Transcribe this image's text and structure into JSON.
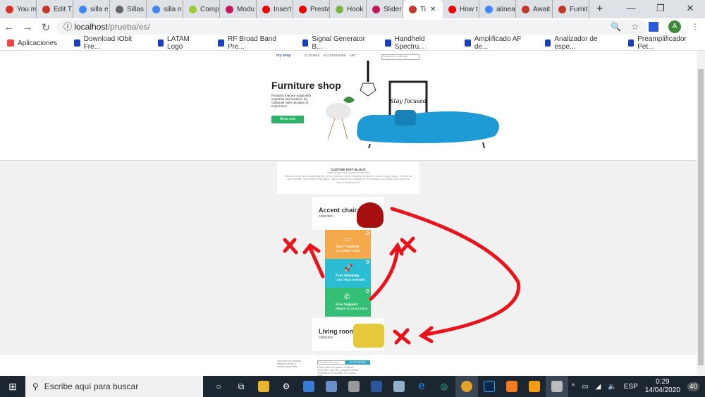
{
  "browser": {
    "tabs": [
      {
        "label": "You m",
        "color": "#d93025"
      },
      {
        "label": "Edit T",
        "color": "#c0392b"
      },
      {
        "label": "silla e",
        "color": "#4285f4"
      },
      {
        "label": "Sillas",
        "color": "#666"
      },
      {
        "label": "silla n",
        "color": "#4285f4"
      },
      {
        "label": "Comp",
        "color": "#9acd32"
      },
      {
        "label": "Modu",
        "color": "#c2185b"
      },
      {
        "label": "Insert",
        "color": "#e00"
      },
      {
        "label": "Presta",
        "color": "#e00"
      },
      {
        "label": "Hook",
        "color": "#7cb342"
      },
      {
        "label": "Slider",
        "color": "#c2185b"
      },
      {
        "label": "Ti",
        "color": "#c0392b",
        "active": true
      },
      {
        "label": "How t",
        "color": "#e00"
      },
      {
        "label": "alinea",
        "color": "#4285f4"
      },
      {
        "label": "Await",
        "color": "#c0392b"
      },
      {
        "label": "Furnit",
        "color": "#c0392b"
      }
    ],
    "url_host": "localhost",
    "url_path": "/prueba/es/",
    "avatar": "A",
    "bookmarks": [
      "Aplicaciones",
      "Download IObit Fre...",
      "LATAM Logo",
      "RF Broad Band Pre...",
      "Signal Generator B...",
      "Handheld Spectru...",
      "Amplificado AF de...",
      "Analizador de espe...",
      "Preamplificador Pet..."
    ]
  },
  "site": {
    "logo": "my shop",
    "menu": [
      "CLOTHES",
      "ACCESSORIES",
      "ART"
    ],
    "search_placeholder": "Búsqueda en catálogo",
    "hero": {
      "title": "Furniture shop",
      "desc": "Products that are made with expertise and wisdom, by craftsmen with decades of experience.",
      "button": "Shop now",
      "poster": "Stay focused"
    },
    "custom_block": {
      "title": "CUSTOM TEXT BLOCK",
      "subtitle": "Lorem ipsum dolor sit amet conse ctetu",
      "body": "Sit amet conse ctetur adipisicing elit, sed do eiusmod tempor incididunt ut labore et dolore magna aliqua. Ut enim ad minim veniam, quis nostrud exercitation ullamco laboris nisi ut aliquip ex ea commodo consequat. Duis aute irure dolor in reprehenderit."
    },
    "cards": [
      {
        "title": "Accent chair",
        "sub": "collection"
      },
      {
        "title": "Living room",
        "sub": "collection"
      }
    ],
    "features": [
      {
        "title": "Easy Payment",
        "sub": "ALL CREDIT CARD",
        "color": "#f5a94a"
      },
      {
        "title": "Free Shipping",
        "sub": "LESS THAN 24 HOURS",
        "color": "#2bbdd4"
      },
      {
        "title": "Free Support",
        "sub": "FROM 8 TO 24 ALL DAYS",
        "color": "#34c074"
      }
    ],
    "newsletter": {
      "text": "Infórmate de nuestras últimas noticias y ofertas especiales.",
      "placeholder": "Su dirección de correo",
      "button": "SUSCRIBIRSE",
      "consent": "Puede darse de baja en cualquier momento. Para ello, consulte nuestra información de contacto en el aviso legal."
    }
  },
  "taskbar": {
    "search": "Escribe aquí para buscar",
    "lang": "ESP",
    "time": "0:29",
    "date": "14/04/2020",
    "notifications": "40"
  }
}
